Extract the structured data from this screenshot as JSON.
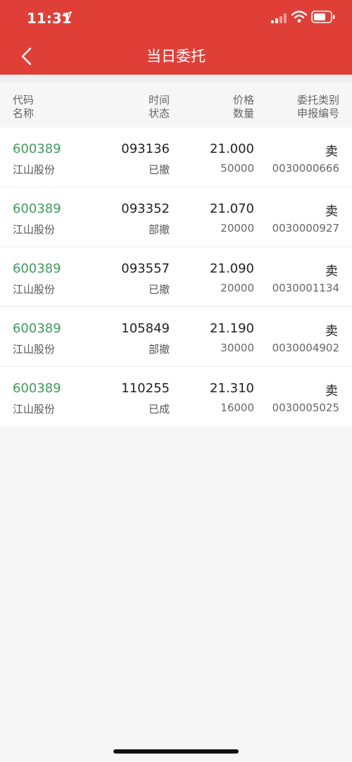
{
  "status_bar": {
    "time": "11:31"
  },
  "nav": {
    "title": "当日委托"
  },
  "columns": {
    "code": "代码",
    "name": "名称",
    "time": "时间",
    "status": "状态",
    "price": "价格",
    "quantity": "数量",
    "order_type": "委托类别",
    "order_no": "申报编号"
  },
  "orders": [
    {
      "code": "600389",
      "name": "江山股份",
      "time": "093136",
      "status": "已撤",
      "price": "21.000",
      "quantity": "50000",
      "side": "卖",
      "order_no": "0030000666"
    },
    {
      "code": "600389",
      "name": "江山股份",
      "time": "093352",
      "status": "部撤",
      "price": "21.070",
      "quantity": "20000",
      "side": "卖",
      "order_no": "0030000927"
    },
    {
      "code": "600389",
      "name": "江山股份",
      "time": "093557",
      "status": "已撤",
      "price": "21.090",
      "quantity": "20000",
      "side": "卖",
      "order_no": "0030001134"
    },
    {
      "code": "600389",
      "name": "江山股份",
      "time": "105849",
      "status": "部撤",
      "price": "21.190",
      "quantity": "30000",
      "side": "卖",
      "order_no": "0030004902"
    },
    {
      "code": "600389",
      "name": "江山股份",
      "time": "110255",
      "status": "已成",
      "price": "21.310",
      "quantity": "16000",
      "side": "卖",
      "order_no": "0030005025"
    }
  ],
  "colors": {
    "header": "#df3f37",
    "stock_code": "#3f9a5a"
  },
  "icons": [
    "location-arrow-icon",
    "signal-icon",
    "wifi-icon",
    "battery-icon",
    "back-chevron-icon"
  ]
}
